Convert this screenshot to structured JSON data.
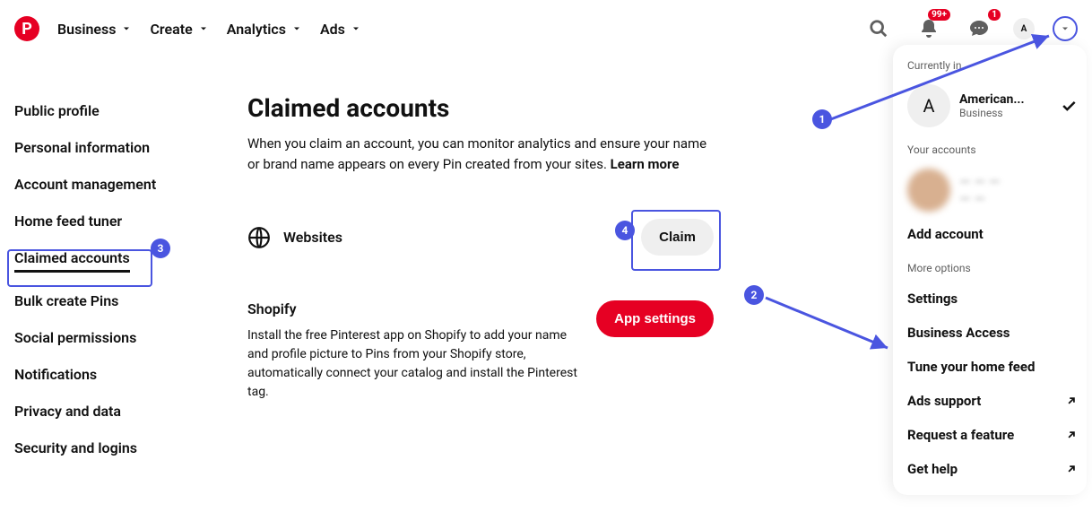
{
  "topnav": {
    "items": [
      "Business",
      "Create",
      "Analytics",
      "Ads"
    ],
    "notif_badge": "99+",
    "msg_badge": "1",
    "avatar_letter": "A"
  },
  "sidebar": {
    "items": [
      "Public profile",
      "Personal information",
      "Account management",
      "Home feed tuner",
      "Claimed accounts",
      "Bulk create Pins",
      "Social permissions",
      "Notifications",
      "Privacy and data",
      "Security and logins"
    ],
    "active_index": 4
  },
  "main": {
    "heading": "Claimed accounts",
    "desc": "When you claim an account, you can monitor analytics and ensure your name or brand name appears on every Pin created from your sites. ",
    "learn_more": "Learn more",
    "websites_label": "Websites",
    "claim_btn": "Claim",
    "shopify_title": "Shopify",
    "shopify_desc": "Install the free Pinterest app on Shopify to add your name and profile picture to Pins from your Shopify store, automatically connect your catalog and install the Pinterest tag.",
    "app_settings_btn": "App settings"
  },
  "panel": {
    "currently_in": "Currently in",
    "acct_name": "American...",
    "acct_type": "Business",
    "acct_letter": "A",
    "your_accounts": "Your accounts",
    "add_account": "Add account",
    "more_options": "More options",
    "menu": [
      {
        "label": "Settings",
        "ext": false
      },
      {
        "label": "Business Access",
        "ext": false
      },
      {
        "label": "Tune your home feed",
        "ext": false
      },
      {
        "label": "Ads support",
        "ext": true
      },
      {
        "label": "Request a feature",
        "ext": true
      },
      {
        "label": "Get help",
        "ext": true
      }
    ]
  },
  "callouts": {
    "c1": "1",
    "c2": "2",
    "c3": "3",
    "c4": "4"
  }
}
